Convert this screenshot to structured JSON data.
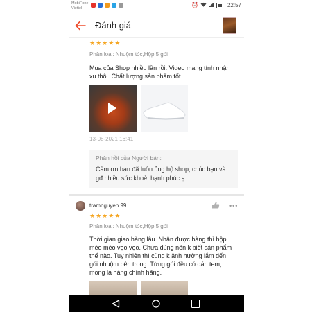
{
  "status_bar": {
    "carrier_line1": "MobiFone",
    "carrier_line2": "Viettel",
    "time": "22:57",
    "colors": {
      "app1": "#e6332a",
      "app2": "#2a6fd6",
      "app3": "#f29a1d",
      "app4": "#2aa4e6",
      "app5": "#999999"
    }
  },
  "header": {
    "title": "Đánh giá",
    "back_icon": "back-arrow-icon",
    "accent": "#ee4d2d"
  },
  "reviews": [
    {
      "rating": 5,
      "variant": "Phân loại: Nhuộm tóc,Hộp 5 gói",
      "text": "Mua của Shop nhiều lần rồi. Video mang tính nhận xu thôi. Chất lượng sản phẩm tốt",
      "timestamp": "13-08-2021 16:41",
      "seller_reply": {
        "title": "Phản hồi của Người bán:",
        "text": "Cảm ơn bạn đã luôn ủng hộ shop, chúc bạn và gđ nhiều sức khoẻ, hạnh phúc ạ"
      }
    },
    {
      "username": "tramnguyen.99",
      "rating": 5,
      "variant": "Phân loại: Nhuộm tóc,Hộp 5 gói",
      "text": "Thời gian giao hàng lâu. Nhận được hàng thì hộp méo méo vẹo vẹo. Chưa dùng nên k biết sản phẩm thế nào. Tuy nhiên thì cũng k ảnh hưởng lắm đến gói nhuộm bên trong. Từng gói đều có dán tem, mong là hàng chính hãng."
    }
  ],
  "nav": {
    "back_icon": "triangle-back-icon",
    "home_icon": "circle-home-icon",
    "recent_icon": "square-recent-icon"
  }
}
